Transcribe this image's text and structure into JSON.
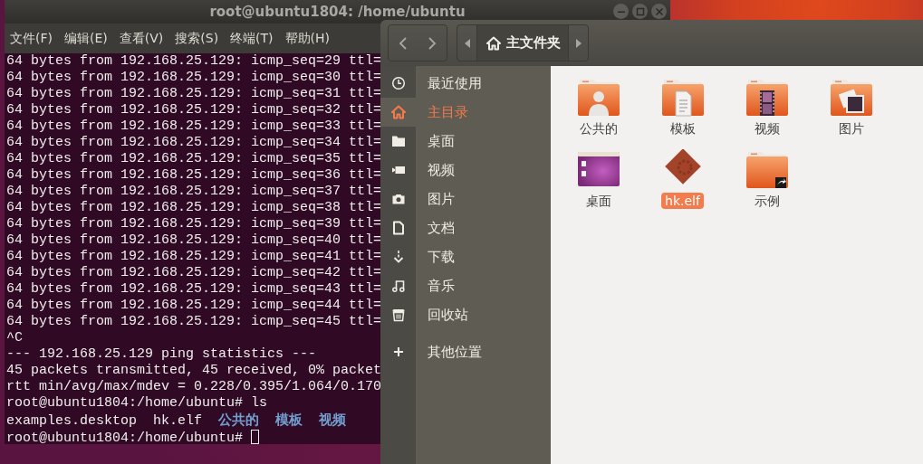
{
  "terminal": {
    "title": "root@ubuntu1804: /home/ubuntu",
    "menu": [
      "文件(F)",
      "编辑(E)",
      "查看(V)",
      "搜索(S)",
      "终端(T)",
      "帮助(H)"
    ],
    "lines": [
      {
        "kind": "text",
        "text": "64 bytes from 192.168.25.129: icmp_seq=29 ttl="
      },
      {
        "kind": "text",
        "text": "64 bytes from 192.168.25.129: icmp_seq=30 ttl="
      },
      {
        "kind": "text",
        "text": "64 bytes from 192.168.25.129: icmp_seq=31 ttl="
      },
      {
        "kind": "text",
        "text": "64 bytes from 192.168.25.129: icmp_seq=32 ttl="
      },
      {
        "kind": "text",
        "text": "64 bytes from 192.168.25.129: icmp_seq=33 ttl="
      },
      {
        "kind": "text",
        "text": "64 bytes from 192.168.25.129: icmp_seq=34 ttl="
      },
      {
        "kind": "text",
        "text": "64 bytes from 192.168.25.129: icmp_seq=35 ttl="
      },
      {
        "kind": "text",
        "text": "64 bytes from 192.168.25.129: icmp_seq=36 ttl="
      },
      {
        "kind": "text",
        "text": "64 bytes from 192.168.25.129: icmp_seq=37 ttl="
      },
      {
        "kind": "text",
        "text": "64 bytes from 192.168.25.129: icmp_seq=38 ttl="
      },
      {
        "kind": "text",
        "text": "64 bytes from 192.168.25.129: icmp_seq=39 ttl="
      },
      {
        "kind": "text",
        "text": "64 bytes from 192.168.25.129: icmp_seq=40 ttl="
      },
      {
        "kind": "text",
        "text": "64 bytes from 192.168.25.129: icmp_seq=41 ttl="
      },
      {
        "kind": "text",
        "text": "64 bytes from 192.168.25.129: icmp_seq=42 ttl="
      },
      {
        "kind": "text",
        "text": "64 bytes from 192.168.25.129: icmp_seq=43 ttl="
      },
      {
        "kind": "text",
        "text": "64 bytes from 192.168.25.129: icmp_seq=44 ttl="
      },
      {
        "kind": "text",
        "text": "64 bytes from 192.168.25.129: icmp_seq=45 ttl="
      },
      {
        "kind": "text",
        "text": "^C"
      },
      {
        "kind": "text",
        "text": "--- 192.168.25.129 ping statistics ---"
      },
      {
        "kind": "text",
        "text": "45 packets transmitted, 45 received, 0% packet"
      },
      {
        "kind": "text",
        "text": "rtt min/avg/max/mdev = 0.228/0.395/1.064/0.170"
      },
      {
        "kind": "text",
        "text": "root@ubuntu1804:/home/ubuntu# ls"
      },
      {
        "kind": "listing",
        "entries": [
          {
            "name": "examples.desktop",
            "kind": "file"
          },
          {
            "name": "hk.elf",
            "kind": "file"
          },
          {
            "name": "公共的",
            "kind": "dir"
          },
          {
            "name": "模板",
            "kind": "dir"
          },
          {
            "name": "视频",
            "kind": "dir"
          }
        ]
      },
      {
        "kind": "prompt",
        "text": "root@ubuntu1804:/home/ubuntu#"
      }
    ]
  },
  "files": {
    "path": "主文件夹",
    "sidebar": [
      {
        "label": "最近使用",
        "kind": "recent",
        "selected": false
      },
      {
        "label": "主目录",
        "kind": "home",
        "selected": true
      },
      {
        "label": "桌面",
        "kind": "desktop",
        "selected": false
      },
      {
        "label": "视频",
        "kind": "videos",
        "selected": false
      },
      {
        "label": "图片",
        "kind": "pictures",
        "selected": false
      },
      {
        "label": "文档",
        "kind": "documents",
        "selected": false
      },
      {
        "label": "下载",
        "kind": "downloads",
        "selected": false
      },
      {
        "label": "音乐",
        "kind": "music",
        "selected": false
      },
      {
        "label": "回收站",
        "kind": "trash",
        "selected": false
      },
      {
        "label": "其他位置",
        "kind": "other",
        "selected": false
      }
    ],
    "items": [
      {
        "name": "公共的",
        "kind": "public",
        "selected": false
      },
      {
        "name": "模板",
        "kind": "templates",
        "selected": false
      },
      {
        "name": "视频",
        "kind": "videos",
        "selected": false
      },
      {
        "name": "图片",
        "kind": "pictures",
        "selected": false
      },
      {
        "name": "桌面",
        "kind": "desktop",
        "selected": false
      },
      {
        "name": "hk.elf",
        "kind": "executable",
        "selected": true
      },
      {
        "name": "示例",
        "kind": "link",
        "selected": false
      }
    ]
  }
}
